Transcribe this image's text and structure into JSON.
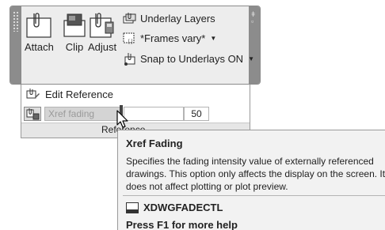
{
  "ribbon": {
    "attach_label": "Attach",
    "clip_label": "Clip",
    "adjust_label": "Adjust",
    "underlay_layers_label": "Underlay Layers",
    "frames_label": "*Frames vary*",
    "snap_label": "Snap to Underlays ON"
  },
  "reference_panel": {
    "edit_reference_label": "Edit Reference",
    "xref_fading_label": "Xref fading",
    "xref_fading_value": "50",
    "panel_title": "Reference"
  },
  "tooltip": {
    "title": "Xref Fading",
    "description_lines": [
      "Specifies the fading intensity value of externally referenced",
      "drawings. This option only affects the display on the screen. It",
      "does not affect plotting or plot preview."
    ],
    "command": "XDWGFADECTL",
    "help": "Press F1 for more help"
  }
}
